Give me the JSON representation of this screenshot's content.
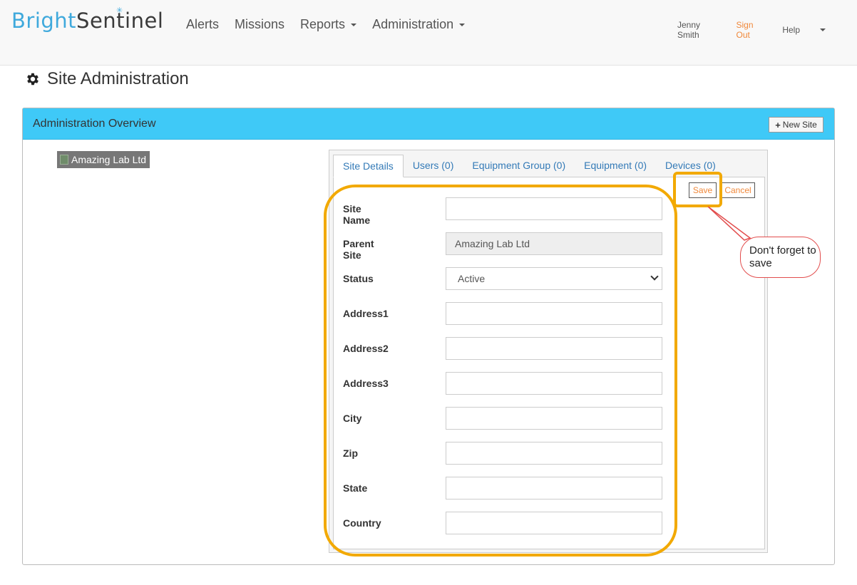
{
  "brand": {
    "part1": "Bright",
    "part2": "Sentinel"
  },
  "nav": {
    "alerts": "Alerts",
    "missions": "Missions",
    "reports": "Reports",
    "administration": "Administration"
  },
  "user": {
    "name": "Jenny Smith",
    "signout": "Sign Out",
    "help": "Help"
  },
  "page": {
    "title": "Site Administration"
  },
  "panel": {
    "title": "Administration Overview",
    "new_site": "New Site"
  },
  "tree": {
    "node": "Amazing Lab Ltd"
  },
  "tabs": [
    "Site Details",
    "Users (0)",
    "Equipment Group (0)",
    "Equipment (0)",
    "Devices (0)"
  ],
  "actions": {
    "save": "Save",
    "cancel": "Cancel"
  },
  "form": {
    "site_name": {
      "label": "Site Name",
      "value": ""
    },
    "parent_site": {
      "label": "Parent Site",
      "value": "Amazing Lab Ltd"
    },
    "status": {
      "label": "Status",
      "value": "Active"
    },
    "address1": {
      "label": "Address1",
      "value": ""
    },
    "address2": {
      "label": "Address2",
      "value": ""
    },
    "address3": {
      "label": "Address3",
      "value": ""
    },
    "city": {
      "label": "City",
      "value": ""
    },
    "zip": {
      "label": "Zip",
      "value": ""
    },
    "state": {
      "label": "State",
      "value": ""
    },
    "country": {
      "label": "Country",
      "value": ""
    }
  },
  "annotation": {
    "callout": "Don't forget to save",
    "highlight_color": "#f2a900",
    "callout_color": "#e24d4d"
  },
  "colors": {
    "accent": "#3fc9f7",
    "link": "#337ab7",
    "orange": "#f0883a"
  }
}
